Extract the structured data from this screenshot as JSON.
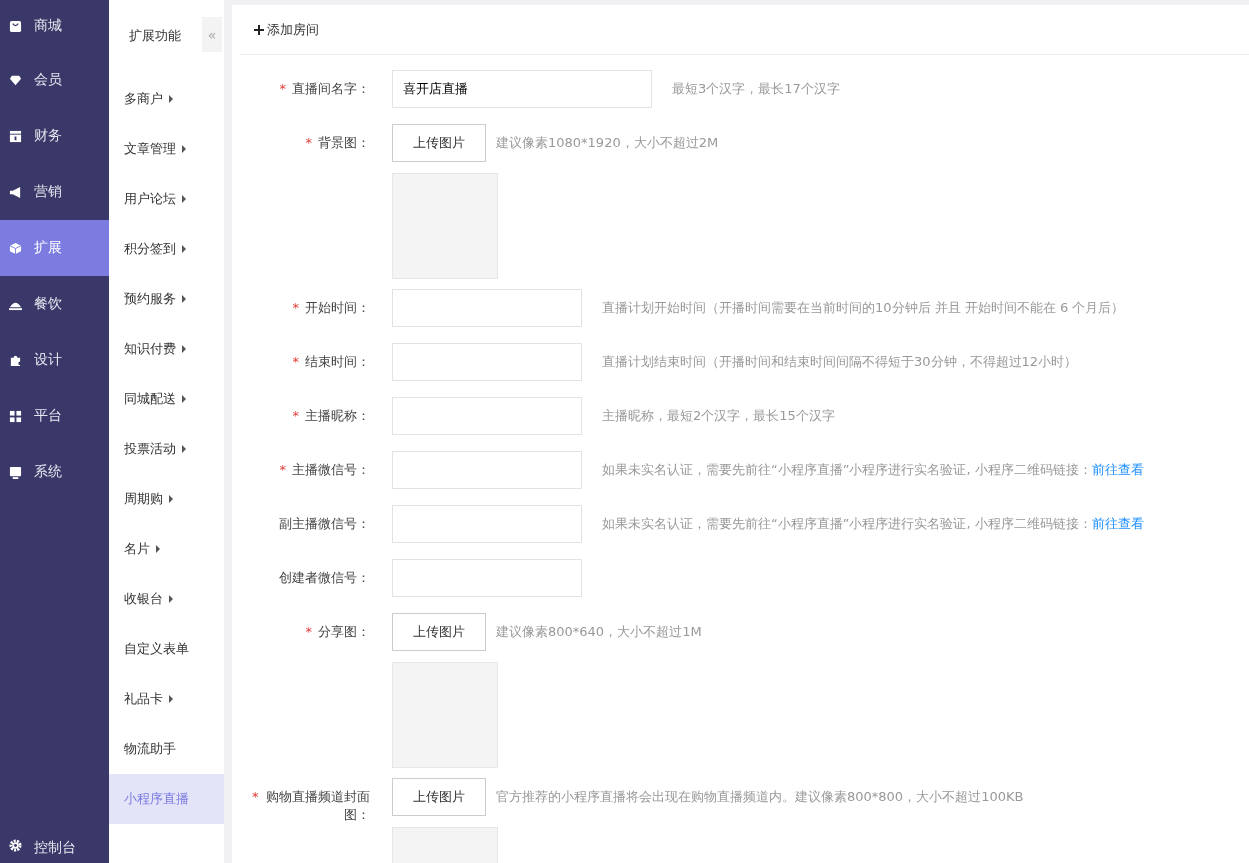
{
  "nav": {
    "items": [
      {
        "label": "商城",
        "selected": false
      },
      {
        "label": "会员",
        "selected": false
      },
      {
        "label": "财务",
        "selected": false
      },
      {
        "label": "营销",
        "selected": false
      },
      {
        "label": "扩展",
        "selected": true
      },
      {
        "label": "餐饮",
        "selected": false
      },
      {
        "label": "设计",
        "selected": false
      },
      {
        "label": "平台",
        "selected": false
      },
      {
        "label": "系统",
        "selected": false
      }
    ],
    "footer": {
      "label": "控制台"
    }
  },
  "subnav": {
    "title": "扩展功能",
    "collapse": "«",
    "items": [
      {
        "label": "多商户",
        "has_children": true,
        "selected": false
      },
      {
        "label": "文章管理",
        "has_children": true,
        "selected": false
      },
      {
        "label": "用户论坛",
        "has_children": true,
        "selected": false
      },
      {
        "label": "积分签到",
        "has_children": true,
        "selected": false
      },
      {
        "label": "预约服务",
        "has_children": true,
        "selected": false
      },
      {
        "label": "知识付费",
        "has_children": true,
        "selected": false
      },
      {
        "label": "同城配送",
        "has_children": true,
        "selected": false
      },
      {
        "label": "投票活动",
        "has_children": true,
        "selected": false
      },
      {
        "label": "周期购",
        "has_children": true,
        "selected": false
      },
      {
        "label": "名片",
        "has_children": true,
        "selected": false
      },
      {
        "label": "收银台",
        "has_children": true,
        "selected": false
      },
      {
        "label": "自定义表单",
        "has_children": false,
        "selected": false
      },
      {
        "label": "礼品卡",
        "has_children": true,
        "selected": false
      },
      {
        "label": "物流助手",
        "has_children": false,
        "selected": false
      },
      {
        "label": "小程序直播",
        "has_children": false,
        "selected": true
      }
    ]
  },
  "header": {
    "title": "添加房间"
  },
  "form": [
    {
      "kind": "text",
      "label": "直播间名字：",
      "required_mark": "*",
      "value": "喜开店直播",
      "wide": true,
      "hint": "最短3个汉字，最长17个汉字"
    },
    {
      "kind": "upload",
      "label": "背景图：",
      "required_mark": "*",
      "button": "上传图片",
      "hint": "建议像素1080*1920，大小不超过2M"
    },
    {
      "kind": "text",
      "label": "开始时间：",
      "required_mark": "*",
      "hint": "直播计划开始时间（开播时间需要在当前时间的10分钟后 并且 开始时间不能在 6 个月后）"
    },
    {
      "kind": "text",
      "label": "结束时间：",
      "required_mark": "*",
      "hint": "直播计划结束时间（开播时间和结束时间间隔不得短于30分钟，不得超过12小时）"
    },
    {
      "kind": "text",
      "label": "主播昵称：",
      "required_mark": "*",
      "hint": "主播昵称，最短2个汉字，最长15个汉字"
    },
    {
      "kind": "text",
      "label": "主播微信号：",
      "required_mark": "*",
      "hint": "如果未实名认证，需要先前往“小程序直播”小程序进行实名验证, 小程序二维码链接：",
      "link": "前往查看"
    },
    {
      "kind": "text",
      "label": "副主播微信号：",
      "hint": "如果未实名认证，需要先前往“小程序直播”小程序进行实名验证, 小程序二维码链接：",
      "link": "前往查看"
    },
    {
      "kind": "text",
      "label": "创建者微信号："
    },
    {
      "kind": "upload",
      "label": "分享图：",
      "required_mark": "*",
      "button": "上传图片",
      "hint": "建议像素800*640，大小不超过1M"
    },
    {
      "kind": "upload",
      "label": "购物直播频道封面图：",
      "required_mark": "*",
      "button": "上传图片",
      "hint": "官方推荐的小程序直播将会出现在购物直播频道内。建议像素800*800，大小不超过100KB"
    }
  ]
}
